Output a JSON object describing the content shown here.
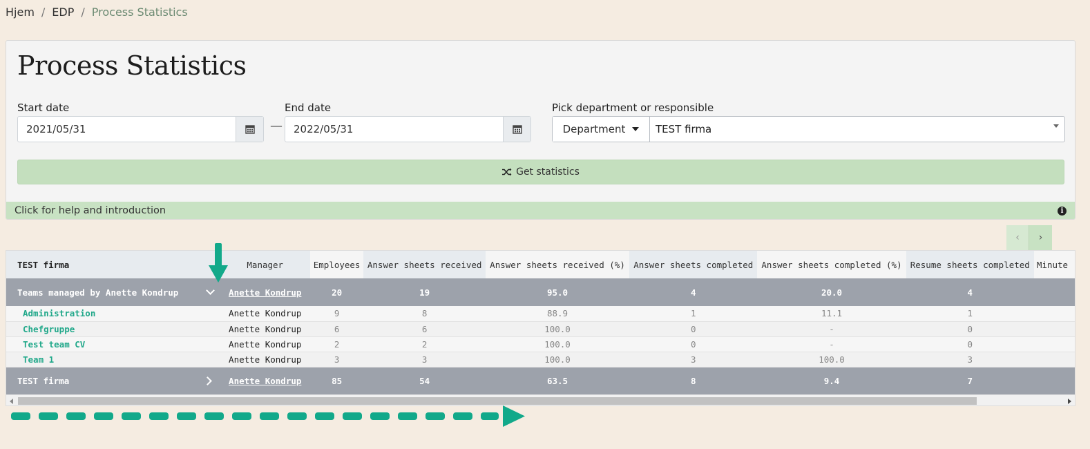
{
  "breadcrumb": {
    "items": [
      "Hjem",
      "EDP"
    ],
    "separator": "/",
    "current": "Process Statistics"
  },
  "page": {
    "title": "Process Statistics"
  },
  "filters": {
    "start_date_label": "Start date",
    "start_date_value": "2021/05/31",
    "end_date_label": "End date",
    "end_date_value": "2022/05/31",
    "range_separator": "—",
    "pick_label": "Pick department or responsible",
    "pick_type": "Department",
    "pick_value": "TEST firma"
  },
  "actions": {
    "get_statistics": "Get statistics",
    "help": "Click for help and introduction"
  },
  "pager": {
    "prev": "‹",
    "next": "›"
  },
  "table": {
    "corner": "TEST firma",
    "columns": [
      "Manager",
      "Employees",
      "Answer sheets received",
      "Answer sheets received (%)",
      "Answer sheets completed",
      "Answer sheets completed (%)",
      "Resume sheets completed",
      "Minute"
    ],
    "group1": {
      "name": "Teams managed by Anette Kondrup",
      "manager": "Anette Kondrup",
      "values": [
        "20",
        "19",
        "95.0",
        "4",
        "20.0",
        "4"
      ]
    },
    "rows": [
      {
        "name": "Administration",
        "manager": "Anette Kondrup",
        "values": [
          "9",
          "8",
          "88.9",
          "1",
          "11.1",
          "1"
        ]
      },
      {
        "name": "Chefgruppe",
        "manager": "Anette Kondrup",
        "values": [
          "6",
          "6",
          "100.0",
          "0",
          "-",
          "0"
        ]
      },
      {
        "name": "Test team CV",
        "manager": "Anette Kondrup",
        "values": [
          "2",
          "2",
          "100.0",
          "0",
          "-",
          "0"
        ]
      },
      {
        "name": "Team 1",
        "manager": "Anette Kondrup",
        "values": [
          "3",
          "3",
          "100.0",
          "3",
          "100.0",
          "3"
        ]
      }
    ],
    "group2": {
      "name": "TEST firma",
      "manager": "Anette Kondrup",
      "values": [
        "85",
        "54",
        "63.5",
        "8",
        "9.4",
        "7"
      ]
    }
  },
  "colors": {
    "accent_green": "#c4dfbe",
    "link_teal": "#21a88a",
    "group_row": "#9da2ab",
    "annotation": "#12a98a"
  }
}
